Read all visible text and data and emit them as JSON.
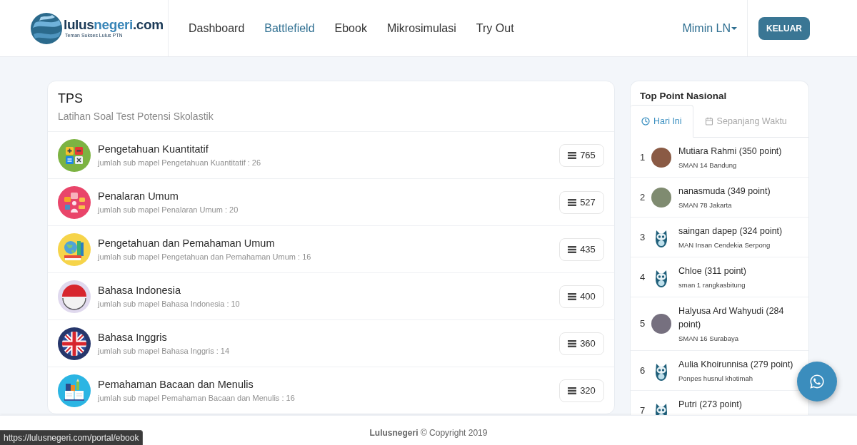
{
  "header": {
    "logo": {
      "wordmark": [
        {
          "text": "lulus",
          "highlight": false
        },
        {
          "text": "negeri",
          "highlight": true
        },
        {
          "text": ".com",
          "highlight": false
        }
      ],
      "tagline": "Teman Sukses Lulus PTN"
    },
    "nav": [
      {
        "label": "Dashboard",
        "selected": false
      },
      {
        "label": "Battlefield",
        "selected": true
      },
      {
        "label": "Ebook",
        "selected": false
      },
      {
        "label": "Mikrosimulasi",
        "selected": false
      },
      {
        "label": "Try Out",
        "selected": false
      }
    ],
    "user_menu": {
      "label": "Mimin LN"
    },
    "logout_button": "KELUAR"
  },
  "tps_card": {
    "title": "TPS",
    "subtitle": "Latihan Soal Test Potensi Skolastik",
    "subjects": [
      {
        "title": "Pengetahuan Kuantitatif",
        "subtitle": "jumlah sub mapel Pengetahuan Kuantitatif : 26",
        "count": "765"
      },
      {
        "title": "Penalaran Umum",
        "subtitle": "jumlah sub mapel Penalaran Umum : 20",
        "count": "527"
      },
      {
        "title": "Pengetahuan dan Pemahaman Umum",
        "subtitle": "jumlah sub mapel Pengetahuan dan Pemahaman Umum : 16",
        "count": "435"
      },
      {
        "title": "Bahasa Indonesia",
        "subtitle": "jumlah sub mapel Bahasa Indonesia : 10",
        "count": "400"
      },
      {
        "title": "Bahasa Inggris",
        "subtitle": "jumlah sub mapel Bahasa Inggris : 14",
        "count": "360"
      },
      {
        "title": "Pemahaman Bacaan dan Menulis",
        "subtitle": "jumlah sub mapel Pemahaman Bacaan dan Menulis : 16",
        "count": "320"
      }
    ]
  },
  "leaderboard": {
    "title": "Top Point Nasional",
    "tabs": [
      {
        "label": "Hari Ini",
        "selected": true
      },
      {
        "label": "Sepanjang Waktu",
        "selected": false
      }
    ],
    "entries": [
      {
        "rank": "1",
        "kind": "photo",
        "name": "Mutiara Rahmi (350 point)",
        "school": "SMAN 14 Bandung"
      },
      {
        "rank": "2",
        "kind": "photo",
        "name": "nanasmuda (349 point)",
        "school": "SMAN 78 Jakarta"
      },
      {
        "rank": "3",
        "kind": "owl",
        "name": "saingan dapep (324 point)",
        "school": "MAN Insan Cendekia Serpong"
      },
      {
        "rank": "4",
        "kind": "owl",
        "name": "Chloe (311 point)",
        "school": "sman 1 rangkasbitung"
      },
      {
        "rank": "5",
        "kind": "photo",
        "name": "Halyusa Ard Wahyudi (284 point)",
        "school": "SMAN 16 Surabaya"
      },
      {
        "rank": "6",
        "kind": "owl",
        "name": "Aulia Khoirunnisa (279 point)",
        "school": "Ponpes husnul khotimah"
      },
      {
        "rank": "7",
        "kind": "owl",
        "name": "Putri (273 point)"
      }
    ]
  },
  "footer": {
    "text": "**Lulusnegeri** © Copyright 2019"
  },
  "status_bar": {
    "url": "https://lulusnegeri.com/portal/ebook"
  }
}
